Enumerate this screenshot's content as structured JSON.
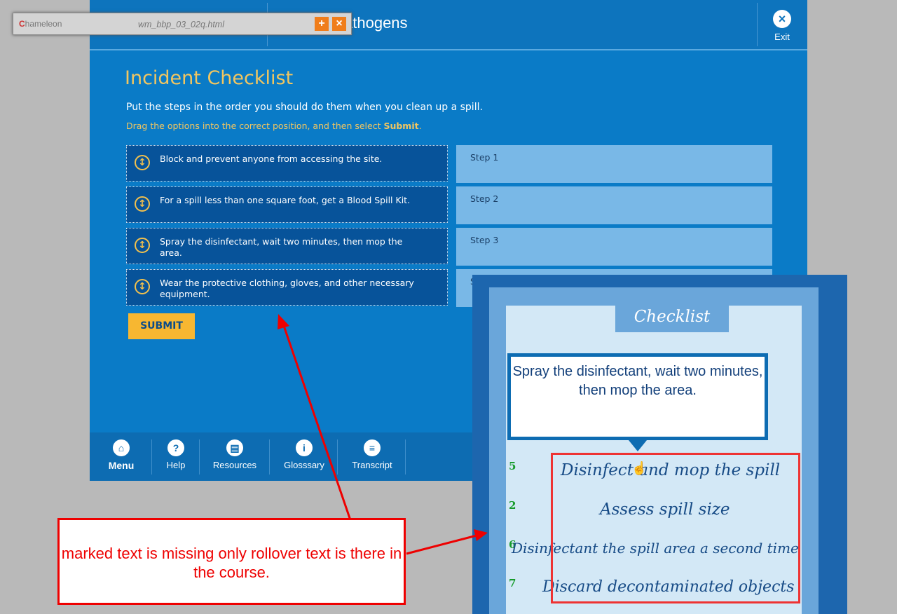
{
  "course": {
    "title": "e Pathogens",
    "exit_label": "Exit",
    "heading": "Incident Checklist",
    "instruction": "Put the steps in the order you should do them when you clean up a spill.",
    "drag_instruction_prefix": "Drag the options into the correct position, and then select ",
    "drag_instruction_bold": "Submit",
    "drag_instruction_suffix": ".",
    "options": [
      "Block and prevent anyone from accessing the site.",
      "For a spill less than one square foot, get a Blood Spill Kit.",
      "Spray the disinfectant, wait two minutes, then mop the area.",
      "Wear the protective clothing, gloves, and other necessary equipment."
    ],
    "steps": [
      "Step 1",
      "Step 2",
      "Step 3",
      "S"
    ],
    "submit_label": "SUBMIT",
    "nav": [
      {
        "label": "Menu",
        "icon": "home-icon"
      },
      {
        "label": "Help",
        "icon": "question-icon"
      },
      {
        "label": "Resources",
        "icon": "document-icon"
      },
      {
        "label": "Glosssary",
        "icon": "info-icon"
      },
      {
        "label": "Transcript",
        "icon": "menu-lines-icon"
      }
    ]
  },
  "chameleon": {
    "logo_text": "hameleon",
    "logo_letter": "C",
    "file_name": "wm_bbp_03_02q.html",
    "add_label": "+",
    "close_label": "×"
  },
  "zoom": {
    "clipboard_title": "Checklist",
    "tooltip": "Spray the disinfectant, wait two minutes, then mop the area.",
    "items": [
      {
        "num": "5",
        "text": "Disinfect and mop the spill"
      },
      {
        "num": "2",
        "text": "Assess spill size"
      },
      {
        "num": "6",
        "text": "Disinfectant the spill area a second time"
      },
      {
        "num": "7",
        "text": "Discard decontaminated objects"
      }
    ]
  },
  "annotation": {
    "text": "marked text is missing only rollover text is there in the course."
  },
  "colors": {
    "course_blue": "#0a7bc7",
    "heading_gold": "#f2c660",
    "submit_gold": "#f7b731",
    "annotation_red": "#ee0000",
    "item_green": "#169b2b"
  }
}
